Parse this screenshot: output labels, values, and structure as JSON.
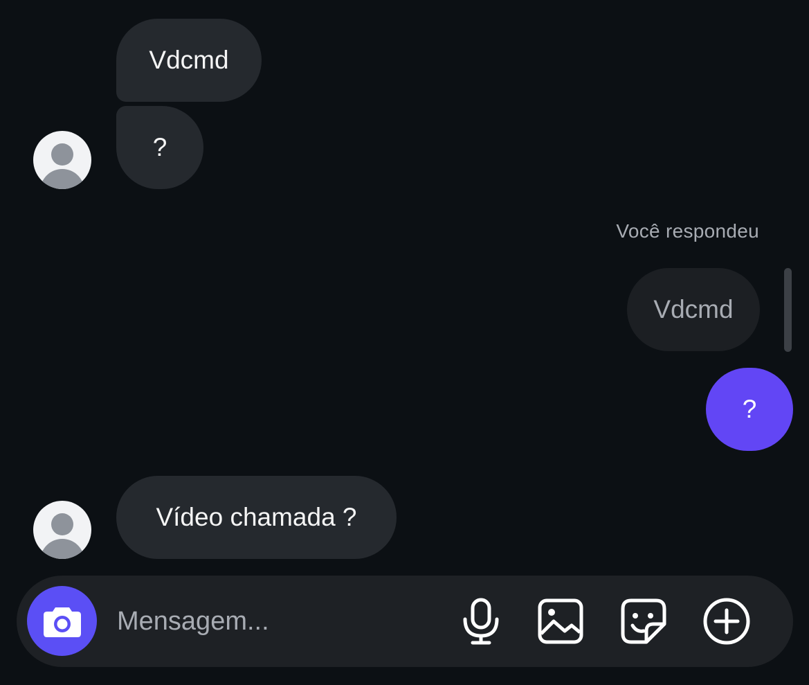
{
  "messages": {
    "incoming_1": "Vdcmd",
    "incoming_2": "?",
    "reply_label": "Você respondeu",
    "replied_to": "Vdcmd",
    "outgoing_1": "?",
    "incoming_3": "Vídeo chamada ?"
  },
  "composer": {
    "placeholder": "Mensagem...",
    "value": ""
  },
  "icons": {
    "camera": "camera-icon",
    "microphone": "microphone-icon",
    "gallery": "image-gallery-icon",
    "sticker": "sticker-icon",
    "plus": "plus-circle-icon"
  },
  "colors": {
    "background": "#0c1014",
    "incoming_bubble": "#25292e",
    "outgoing_bubble": "#6246f5",
    "accent": "#5b4ff5"
  }
}
